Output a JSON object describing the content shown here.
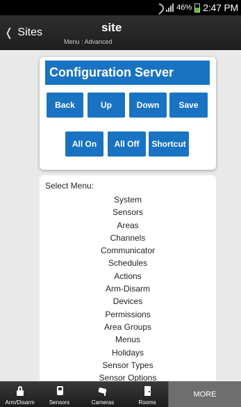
{
  "status_bar": {
    "battery": "46%",
    "time": "2:47 PM"
  },
  "header": {
    "back_label": "Sites",
    "title": "site",
    "subtitle": "Menu : Advanced"
  },
  "config_card": {
    "title": "Configuration Server",
    "buttons": {
      "back": "Back",
      "up": "Up",
      "down": "Down",
      "save": "Save",
      "all_on": "All On",
      "all_off": "All Off",
      "shortcut": "Shortcut"
    }
  },
  "menu": {
    "label": "Select Menu:",
    "items": [
      "System",
      "Sensors",
      "Areas",
      "Channels",
      "Communicator",
      "Schedules",
      "Actions",
      "Arm-Disarm",
      "Devices",
      "Permissions",
      "Area Groups",
      "Menus",
      "Holidays",
      "Sensor Types",
      "Sensor Options"
    ]
  },
  "bottom_nav": {
    "items": [
      {
        "label": "Arm/Disarm",
        "icon": "lock-icon"
      },
      {
        "label": "Sensors",
        "icon": "sensor-icon"
      },
      {
        "label": "Cameras",
        "icon": "camera-icon"
      },
      {
        "label": "Rooms",
        "icon": "door-icon"
      }
    ],
    "more_label": "MORE"
  },
  "colors": {
    "accent": "#1a73c2",
    "battery_fill": "#5ac31f"
  }
}
